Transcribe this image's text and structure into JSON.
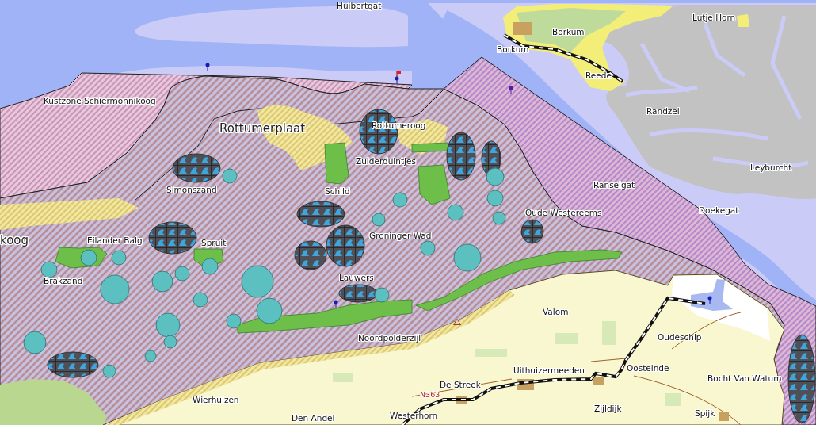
{
  "map": {
    "labels": [
      {
        "text": "Huibertgat",
        "kind": "place"
      },
      {
        "text": "Lutje Horn",
        "kind": "place"
      },
      {
        "text": "Borkum",
        "kind": "place"
      },
      {
        "text": "Borkum",
        "kind": "place"
      },
      {
        "text": "Reede",
        "kind": "place"
      },
      {
        "text": "Kustzone Schiermonnikoog",
        "kind": "place"
      },
      {
        "text": "Randzel",
        "kind": "place"
      },
      {
        "text": "Rottumerplaat",
        "kind": "large"
      },
      {
        "text": "Rottumeroog",
        "kind": "place"
      },
      {
        "text": "Zuiderduintjes",
        "kind": "place"
      },
      {
        "text": "Leyburcht",
        "kind": "place"
      },
      {
        "text": "Simonszand",
        "kind": "place"
      },
      {
        "text": "Schild",
        "kind": "place"
      },
      {
        "text": "Ranselgat",
        "kind": "place"
      },
      {
        "text": "Oude Westereems",
        "kind": "place"
      },
      {
        "text": "Doekegat",
        "kind": "place"
      },
      {
        "text": "koog",
        "kind": "large"
      },
      {
        "text": "Eilander Balg",
        "kind": "place"
      },
      {
        "text": "Spruit",
        "kind": "place"
      },
      {
        "text": "Groninger Wad",
        "kind": "place"
      },
      {
        "text": "Brakzand",
        "kind": "place"
      },
      {
        "text": "Lauwers",
        "kind": "place"
      },
      {
        "text": "Valom",
        "kind": "place"
      },
      {
        "text": "Noordpolderzijl",
        "kind": "place"
      },
      {
        "text": "Oudeschip",
        "kind": "place"
      },
      {
        "text": "Uithuizermeeden",
        "kind": "place"
      },
      {
        "text": "Oosteinde",
        "kind": "place"
      },
      {
        "text": "De Streek",
        "kind": "place"
      },
      {
        "text": "Bocht Van Watum",
        "kind": "place"
      },
      {
        "text": "Wierhuizen",
        "kind": "place"
      },
      {
        "text": "N363",
        "kind": "road"
      },
      {
        "text": "Den Andel",
        "kind": "place"
      },
      {
        "text": "Westerhorn",
        "kind": "place"
      },
      {
        "text": "Zijldijk",
        "kind": "place"
      },
      {
        "text": "Spijk",
        "kind": "place"
      }
    ]
  }
}
